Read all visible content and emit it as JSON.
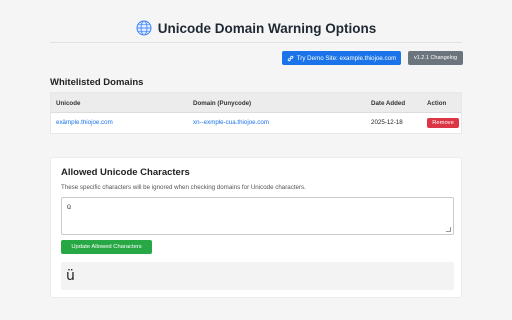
{
  "header": {
    "title": "Unicode Domain Warning Options",
    "icon": "globe-icon"
  },
  "buttons": {
    "demo_label": "Try Demo Site: example.thiojoe.com",
    "demo_icon": "link-icon",
    "changelog_label": "v1.2.1 Changelog",
    "demo_color": "#1a73e8",
    "changelog_color": "#6c757d"
  },
  "whitelist": {
    "title": "Whitelisted Domains",
    "columns": [
      "Unicode",
      "Domain (Punycode)",
      "Date Added",
      "Action"
    ],
    "rows": [
      {
        "unicode": "exämple.thiojoe.com",
        "punycode": "xn--exmple-cua.thiojoe.com",
        "date_added": "2025-12-18",
        "action_label": "Remove"
      }
    ]
  },
  "allowed": {
    "title": "Allowed Unicode Characters",
    "description": "These specific characters will be ignored when checking domains for Unicode characters.",
    "textarea_value": "ü",
    "update_label": "Update Allowed Characters",
    "preview_text": "ü"
  },
  "colors": {
    "remove": "#dc3545",
    "update": "#28a745",
    "link": "#1a73e8"
  }
}
